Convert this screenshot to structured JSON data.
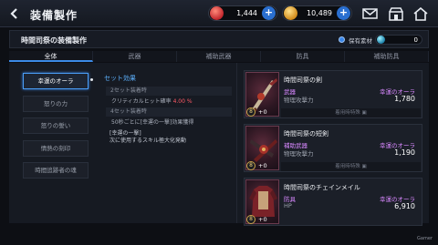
{
  "header": {
    "title": "装備製作",
    "currency_red": "1,444",
    "currency_gold": "10,489",
    "back_icon": "back-arrow-icon",
    "icons": [
      "mail-icon",
      "shop-icon",
      "home-icon"
    ]
  },
  "subheader": {
    "title": "時間司祭の装備製作",
    "owned_label": "保有素材",
    "owned_value": "0"
  },
  "tabs": [
    "全体",
    "武器",
    "補助武器",
    "防具",
    "補助防具"
  ],
  "active_tab": 0,
  "set_list": [
    "幸運のオーラ",
    "怒りの力",
    "怒りの誓い",
    "情熱の刻印",
    "時間追跡者の魂"
  ],
  "active_set": 0,
  "set_effect": {
    "title": "セット効果",
    "row1": "2セット装着時",
    "crit_label": "クリティカルヒット確率",
    "crit_value": "4.00 %",
    "row2": "4セット装着時",
    "proc_text": "50秒ごとに[幸運の一撃]効果獲得",
    "note_title": "[幸運の一撃]",
    "note_body": "次に使用するスキル極大化発動"
  },
  "items": [
    {
      "name": "時間司祭の剣",
      "type": "武器",
      "stat": "物理攻撃力",
      "effect": "幸運のオーラ",
      "value": "1,780",
      "equip": "着用時特殊",
      "level": "8",
      "plus": "+0"
    },
    {
      "name": "時間司祭の短剣",
      "type": "補助武器",
      "stat": "物理攻撃力",
      "effect": "幸運のオーラ",
      "value": "1,190",
      "equip": "着用時特殊",
      "level": "8",
      "plus": "+0"
    },
    {
      "name": "時間司祭のチェインメイル",
      "type": "防具",
      "stat": "HP",
      "effect": "幸運のオーラ",
      "value": "6,910",
      "equip": "",
      "level": "8",
      "plus": "+0"
    }
  ],
  "watermark": "Gamer",
  "colors": {
    "accent": "#3b8ae6",
    "effect": "#d888ff",
    "crit": "#ff5a66",
    "title_blue": "#5db2ff"
  }
}
